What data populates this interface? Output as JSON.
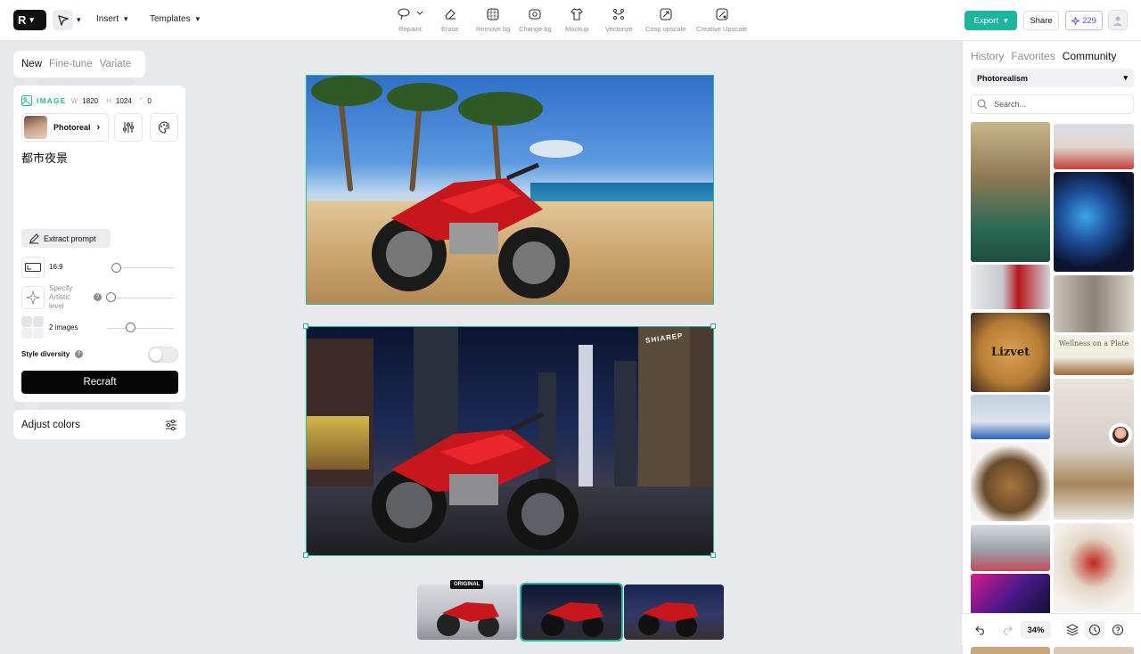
{
  "topbar": {
    "insert_label": "Insert",
    "templates_label": "Templates",
    "tools": [
      {
        "label": "Repaint",
        "icon": "lasso-icon"
      },
      {
        "label": "Erase",
        "icon": "eraser-icon"
      },
      {
        "label": "Remove bg",
        "icon": "remove-bg-icon"
      },
      {
        "label": "Change bg",
        "icon": "change-bg-icon"
      },
      {
        "label": "Mockup",
        "icon": "tshirt-icon"
      },
      {
        "label": "Vectorize",
        "icon": "vectorize-icon"
      },
      {
        "label": "Crisp upscale",
        "icon": "crisp-upscale-icon"
      },
      {
        "label": "Creative Upscale",
        "icon": "creative-upscale-icon"
      }
    ],
    "export_label": "Export",
    "share_label": "Share",
    "credits": "229"
  },
  "left_panel": {
    "tabs": [
      "New",
      "Fine-tune",
      "Variate"
    ],
    "active_tab": "New",
    "image_label": "IMAGE",
    "width_label": "W",
    "width_value": "1820",
    "height_label": "H",
    "height_value": "1024",
    "rotation_value": "0",
    "style_name": "Photoreal",
    "prompt": "都市夜景",
    "extract_prompt_label": "Extract prompt",
    "aspect_label": "16:9",
    "artistic_label_1": "Specify",
    "artistic_label_2": "Artistic",
    "artistic_label_3": "level",
    "images_label": "2 images",
    "style_diversity_label": "Style diversity",
    "recraft_label": "Recraft",
    "adjust_colors_label": "Adjust colors"
  },
  "canvas": {
    "original_tag": "ORIGINAL",
    "night_sign": "SHIAREP"
  },
  "right_panel": {
    "tabs": [
      "History",
      "Favorites",
      "Community"
    ],
    "active_tab": "Community",
    "filter_value": "Photorealism",
    "search_placeholder": "Search...",
    "gallery_text_1": "Lizvet",
    "gallery_text_2": "Wellness on a Plate"
  },
  "bottom_tools": {
    "zoom": "34%"
  },
  "colors": {
    "accent": "#1db59b",
    "credits": "#5b4fe0",
    "recraft_button": "#050505"
  }
}
